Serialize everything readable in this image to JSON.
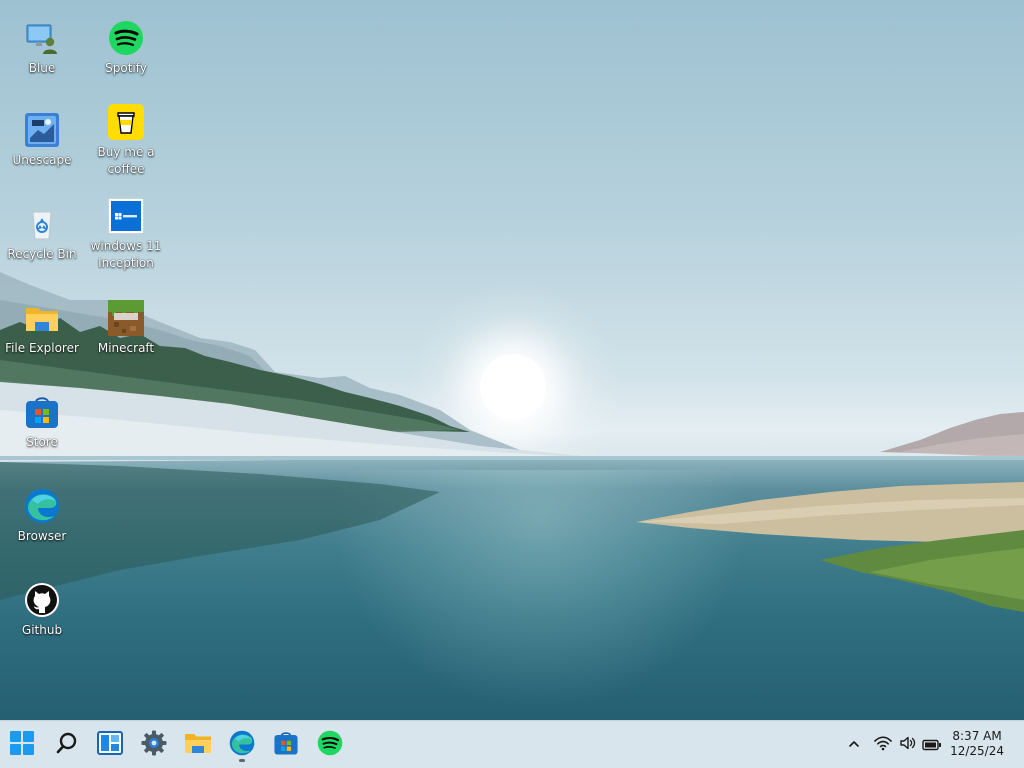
{
  "desktop": {
    "icons": [
      {
        "label": "Blue",
        "icon": "user-pc-icon"
      },
      {
        "label": "Spotify",
        "icon": "spotify-icon"
      },
      {
        "label": "Unescape",
        "icon": "unescape-icon"
      },
      {
        "label": "Buy me a coffee",
        "icon": "coffee-cup-icon"
      },
      {
        "label": "Recycle Bin",
        "icon": "recycle-bin-icon"
      },
      {
        "label": "windows 11 Inception",
        "icon": "windows-window-icon"
      },
      {
        "label": "File Explorer",
        "icon": "folder-icon"
      },
      {
        "label": "Minecraft",
        "icon": "minecraft-icon"
      },
      {
        "label": "Store",
        "icon": "store-bag-icon"
      },
      {
        "label": "Browser",
        "icon": "edge-icon"
      },
      {
        "label": "Github",
        "icon": "github-icon"
      }
    ]
  },
  "taskbar": {
    "apps": [
      {
        "name": "Start",
        "icon": "windows-start-icon"
      },
      {
        "name": "Search",
        "icon": "search-icon"
      },
      {
        "name": "Widgets",
        "icon": "widgets-icon"
      },
      {
        "name": "Settings",
        "icon": "gear-icon"
      },
      {
        "name": "File Explorer",
        "icon": "folder-icon"
      },
      {
        "name": "Browser",
        "icon": "edge-icon",
        "active": true
      },
      {
        "name": "Store",
        "icon": "store-bag-icon"
      },
      {
        "name": "Spotify",
        "icon": "spotify-icon"
      }
    ],
    "tray": {
      "icons": [
        "chevron-up-icon",
        "wifi-icon",
        "volume-icon",
        "battery-icon"
      ],
      "time": "8:37 AM",
      "date": "12/25/24"
    }
  },
  "colors": {
    "taskbar_bg": "#d8e5ec",
    "spotify_green": "#1ed760",
    "windows_blue": "#0078d4",
    "coffee_yellow": "#ffdd00"
  }
}
